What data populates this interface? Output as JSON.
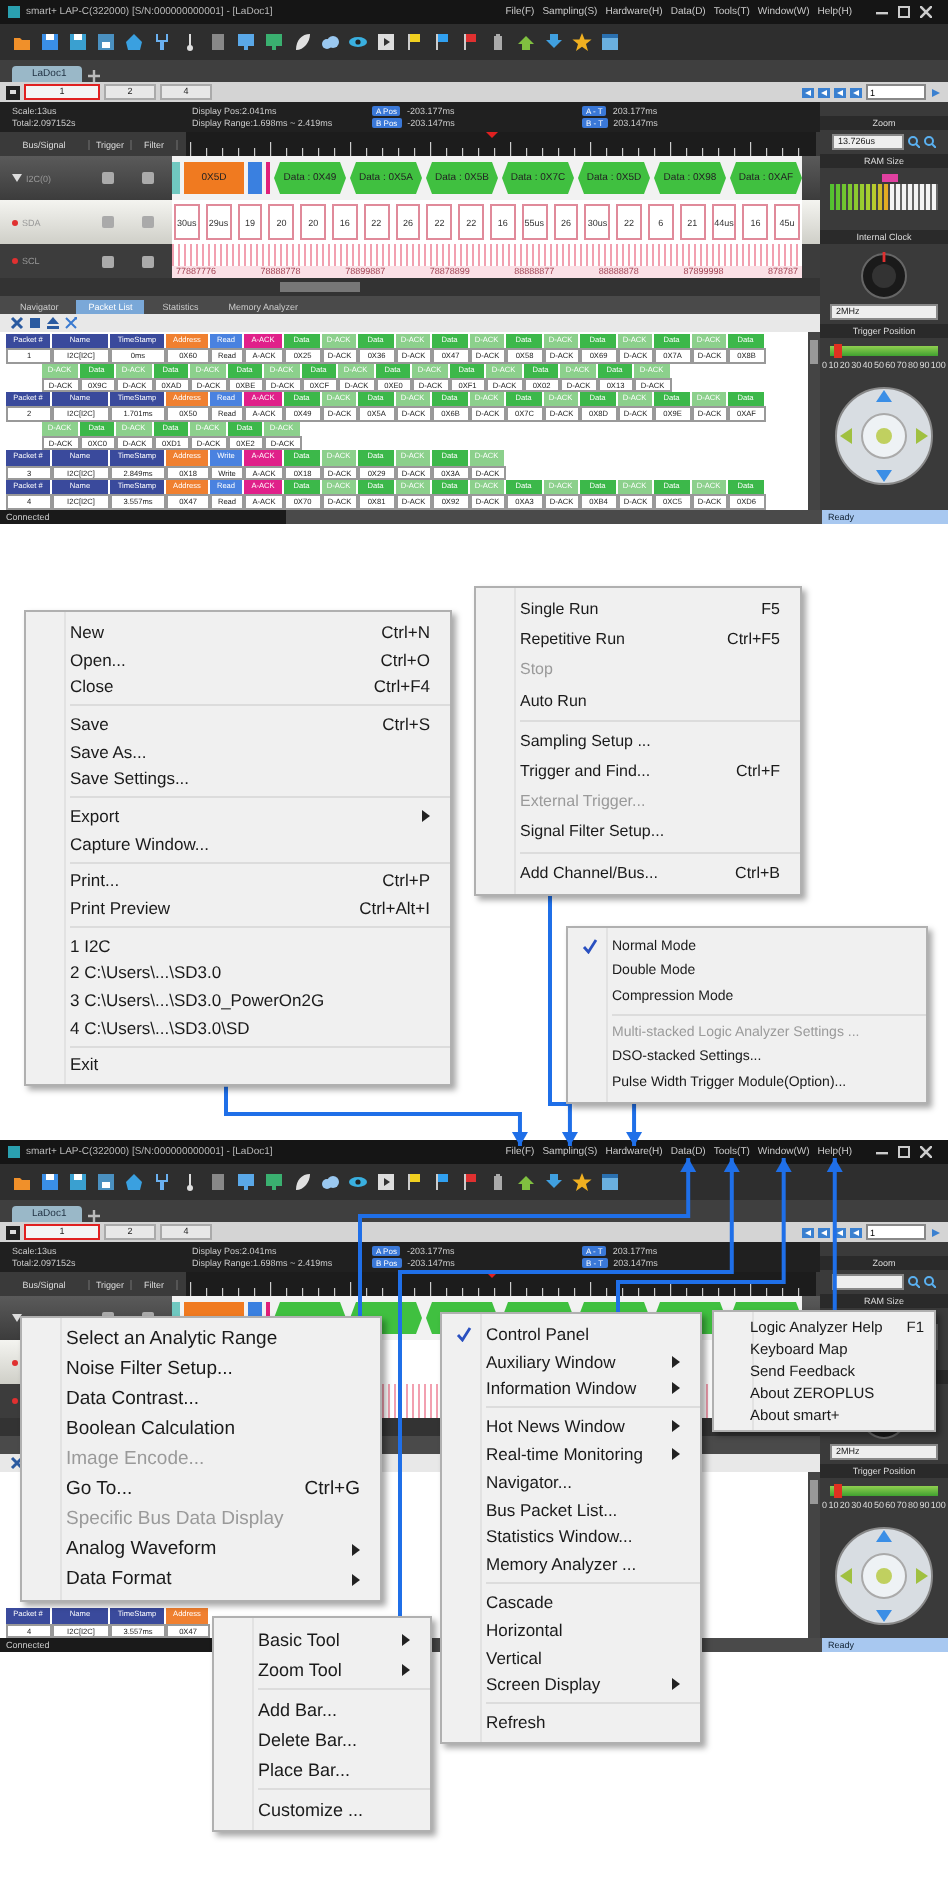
{
  "screens": [
    {
      "title": "smart+ LAP-C(322000) [S/N:000000000001] - [LaDoc1]",
      "menubar": [
        "File(F)",
        "Sampling(S)",
        "Hardware(H)",
        "Data(D)",
        "Tools(T)",
        "Window(W)",
        "Help(H)"
      ],
      "doc_tab": "LaDoc1",
      "page_tabs": [
        {
          "label": "1",
          "selected": true
        },
        {
          "label": "2",
          "selected": false
        },
        {
          "label": "4",
          "selected": false
        }
      ],
      "page_field": "1",
      "info": {
        "scale": "Scale:13us",
        "total": "Total:2.097152s",
        "pos": "Display Pos:2.041ms",
        "range": "Display Range:1.698ms ~ 2.419ms",
        "cursors": [
          {
            "tag": "A Pos",
            "value": "-203.177ms"
          },
          {
            "tag": "B Pos",
            "value": "-203.147ms"
          },
          {
            "tag": "A - T",
            "value": "203.177ms"
          },
          {
            "tag": "B - T",
            "value": "203.147ms"
          }
        ]
      },
      "columns": [
        "Bus/Signal",
        "Trigger",
        "Filter"
      ],
      "signals": [
        {
          "kind": "bus",
          "name": "I2C(0)"
        },
        {
          "kind": "sda",
          "name": "SDA"
        },
        {
          "kind": "scl",
          "name": "SCL"
        }
      ],
      "bus_cells": [
        {
          "kind": "start"
        },
        {
          "kind": "address",
          "label": "0X5D"
        },
        {
          "kind": "rw"
        },
        {
          "kind": "ack"
        },
        {
          "kind": "data",
          "label": "Data : 0X49"
        },
        {
          "kind": "data",
          "label": "Data : 0X5A"
        },
        {
          "kind": "data",
          "label": "Data : 0X5B"
        },
        {
          "kind": "data",
          "label": "Data : 0X7C"
        },
        {
          "kind": "data",
          "label": "Data : 0X5D"
        },
        {
          "kind": "data",
          "label": "Data : 0X98"
        },
        {
          "kind": "data",
          "label": "Data : 0XAF"
        }
      ],
      "sda_pulses": [
        "30us",
        "29us",
        "19",
        "20",
        "20",
        "16",
        "22",
        "26",
        "22",
        "22",
        "16",
        "55us",
        "26",
        "30us",
        "22",
        "6",
        "21",
        "44us",
        "16",
        "45u"
      ],
      "scl_labels": [
        "77887776",
        "78888778",
        "78899887",
        "78878899",
        "88888877",
        "88888878",
        "87899998",
        "878787"
      ],
      "panel_tabs": [
        {
          "label": "Navigator",
          "selected": false
        },
        {
          "label": "Packet List",
          "selected": true
        },
        {
          "label": "Statistics",
          "selected": false
        },
        {
          "label": "Memory Analyzer",
          "selected": false
        }
      ],
      "packets": [
        {
          "heads": [
            "Packet #",
            "Name",
            "TimeStamp"
          ],
          "number": "1",
          "name": "I2C[I2C]",
          "timestamp": "0ms",
          "cells": [
            {
              "kind": "address",
              "head": "Address",
              "value": "0X60"
            },
            {
              "kind": "read",
              "head": "Read",
              "value": "Read"
            },
            {
              "kind": "ack",
              "head": "A-ACK",
              "value": "A-ACK"
            },
            {
              "kind": "data",
              "head": "Data",
              "value": "0X25"
            },
            {
              "kind": "dack",
              "head": "D-ACK",
              "value": "D-ACK"
            },
            {
              "kind": "data",
              "head": "Data",
              "value": "0X36"
            },
            {
              "kind": "dack",
              "head": "D-ACK",
              "value": "D-ACK"
            },
            {
              "kind": "data",
              "head": "Data",
              "value": "0X47"
            },
            {
              "kind": "dack",
              "head": "D-ACK",
              "value": "D-ACK"
            },
            {
              "kind": "data",
              "head": "Data",
              "value": "0X58"
            },
            {
              "kind": "dack",
              "head": "D-ACK",
              "value": "D-ACK"
            },
            {
              "kind": "data",
              "head": "Data",
              "value": "0X69"
            },
            {
              "kind": "dack",
              "head": "D-ACK",
              "value": "D-ACK"
            },
            {
              "kind": "data",
              "head": "Data",
              "value": "0X7A"
            },
            {
              "kind": "dack",
              "head": "D-ACK",
              "value": "D-ACK"
            },
            {
              "kind": "data",
              "head": "Data",
              "value": "0X8B"
            }
          ],
          "more": [
            {
              "kind": "dack",
              "head": "D-ACK",
              "value": "D-ACK"
            },
            {
              "kind": "data",
              "head": "Data",
              "value": "0X9C"
            },
            {
              "kind": "dack",
              "head": "D-ACK",
              "value": "D-ACK"
            },
            {
              "kind": "data",
              "head": "Data",
              "value": "0XAD"
            },
            {
              "kind": "dack",
              "head": "D-ACK",
              "value": "D-ACK"
            },
            {
              "kind": "data",
              "head": "Data",
              "value": "0XBE"
            },
            {
              "kind": "dack",
              "head": "D-ACK",
              "value": "D-ACK"
            },
            {
              "kind": "data",
              "head": "Data",
              "value": "0XCF"
            },
            {
              "kind": "dack",
              "head": "D-ACK",
              "value": "D-ACK"
            },
            {
              "kind": "data",
              "head": "Data",
              "value": "0XE0"
            },
            {
              "kind": "dack",
              "head": "D-ACK",
              "value": "D-ACK"
            },
            {
              "kind": "data",
              "head": "Data",
              "value": "0XF1"
            },
            {
              "kind": "dack",
              "head": "D-ACK",
              "value": "D-ACK"
            },
            {
              "kind": "data",
              "head": "Data",
              "value": "0X02"
            },
            {
              "kind": "dack",
              "head": "D-ACK",
              "value": "D-ACK"
            },
            {
              "kind": "data",
              "head": "Data",
              "value": "0X13"
            },
            {
              "kind": "dack",
              "head": "D-ACK",
              "value": "D-ACK"
            }
          ]
        },
        {
          "heads": [
            "Packet #",
            "Name",
            "TimeStamp"
          ],
          "number": "2",
          "name": "I2C[I2C]",
          "timestamp": "1.701ms",
          "cells": [
            {
              "kind": "address",
              "head": "Address",
              "value": "0X50"
            },
            {
              "kind": "read",
              "head": "Read",
              "value": "Read"
            },
            {
              "kind": "ack",
              "head": "A-ACK",
              "value": "A-ACK"
            },
            {
              "kind": "data",
              "head": "Data",
              "value": "0X49"
            },
            {
              "kind": "dack",
              "head": "D-ACK",
              "value": "D-ACK"
            },
            {
              "kind": "data",
              "head": "Data",
              "value": "0X5A"
            },
            {
              "kind": "dack",
              "head": "D-ACK",
              "value": "D-ACK"
            },
            {
              "kind": "data",
              "head": "Data",
              "value": "0X6B"
            },
            {
              "kind": "dack",
              "head": "D-ACK",
              "value": "D-ACK"
            },
            {
              "kind": "data",
              "head": "Data",
              "value": "0X7C"
            },
            {
              "kind": "dack",
              "head": "D-ACK",
              "value": "D-ACK"
            },
            {
              "kind": "data",
              "head": "Data",
              "value": "0X8D"
            },
            {
              "kind": "dack",
              "head": "D-ACK",
              "value": "D-ACK"
            },
            {
              "kind": "data",
              "head": "Data",
              "value": "0X9E"
            },
            {
              "kind": "dack",
              "head": "D-ACK",
              "value": "D-ACK"
            },
            {
              "kind": "data",
              "head": "Data",
              "value": "0XAF"
            }
          ],
          "more": [
            {
              "kind": "dack",
              "head": "D-ACK",
              "value": "D-ACK"
            },
            {
              "kind": "data",
              "head": "Data",
              "value": "0XC0"
            },
            {
              "kind": "dack",
              "head": "D-ACK",
              "value": "D-ACK"
            },
            {
              "kind": "data",
              "head": "Data",
              "value": "0XD1"
            },
            {
              "kind": "dack",
              "head": "D-ACK",
              "value": "D-ACK"
            },
            {
              "kind": "data",
              "head": "Data",
              "value": "0XE2"
            },
            {
              "kind": "dack",
              "head": "D-ACK",
              "value": "D-ACK"
            }
          ]
        },
        {
          "heads": [
            "Packet #",
            "Name",
            "TimeStamp"
          ],
          "number": "3",
          "name": "I2C[I2C]",
          "timestamp": "2.849ms",
          "cells": [
            {
              "kind": "address",
              "head": "Address",
              "value": "0X18"
            },
            {
              "kind": "write",
              "head": "Write",
              "value": "Write"
            },
            {
              "kind": "ack",
              "head": "A-ACK",
              "value": "A-ACK"
            },
            {
              "kind": "data",
              "head": "Data",
              "value": "0X18"
            },
            {
              "kind": "dack",
              "head": "D-ACK",
              "value": "D-ACK"
            },
            {
              "kind": "data",
              "head": "Data",
              "value": "0X29"
            },
            {
              "kind": "dack",
              "head": "D-ACK",
              "value": "D-ACK"
            },
            {
              "kind": "data",
              "head": "Data",
              "value": "0X3A"
            },
            {
              "kind": "dack",
              "head": "D-ACK",
              "value": "D-ACK"
            }
          ]
        },
        {
          "heads": [
            "Packet #",
            "Name",
            "TimeStamp"
          ],
          "number": "4",
          "name": "I2C[I2C]",
          "timestamp": "3.557ms",
          "cells": [
            {
              "kind": "address",
              "head": "Address",
              "value": "0X47"
            },
            {
              "kind": "read",
              "head": "Read",
              "value": "Read"
            },
            {
              "kind": "ack",
              "head": "A-ACK",
              "value": "A-ACK"
            },
            {
              "kind": "data",
              "head": "Data",
              "value": "0X70"
            },
            {
              "kind": "dack",
              "head": "D-ACK",
              "value": "D-ACK"
            },
            {
              "kind": "data",
              "head": "Data",
              "value": "0X81"
            },
            {
              "kind": "dack",
              "head": "D-ACK",
              "value": "D-ACK"
            },
            {
              "kind": "data",
              "head": "Data",
              "value": "0X92"
            },
            {
              "kind": "dack",
              "head": "D-ACK",
              "value": "D-ACK"
            },
            {
              "kind": "data",
              "head": "Data",
              "value": "0XA3"
            },
            {
              "kind": "dack",
              "head": "D-ACK",
              "value": "D-ACK"
            },
            {
              "kind": "data",
              "head": "Data",
              "value": "0XB4"
            },
            {
              "kind": "dack",
              "head": "D-ACK",
              "value": "D-ACK"
            },
            {
              "kind": "data",
              "head": "Data",
              "value": "0XC5"
            },
            {
              "kind": "dack",
              "head": "D-ACK",
              "value": "D-ACK"
            },
            {
              "kind": "data",
              "head": "Data",
              "value": "0XD6"
            }
          ]
        }
      ],
      "side": {
        "zoom_title": "Zoom",
        "zoom_value": "13.726us",
        "ram_title": "RAM Size",
        "ram_meter": {
          "level": 0.55
        },
        "clock_title": "Internal Clock",
        "clock_value": "2MHz",
        "trigger_title": "Trigger Position",
        "trigger_slider": {
          "level": 0.08
        },
        "trigger_scale": [
          "0",
          "10",
          "20",
          "30",
          "40",
          "50",
          "60",
          "70",
          "80",
          "90",
          "100"
        ]
      },
      "status": {
        "left": "Connected",
        "right": "Ready"
      }
    },
    {
      "title": "smart+ LAP-C(322000) [S/N:000000000001] - [LaDoc1]",
      "menubar": [
        "File(F)",
        "Sampling(S)",
        "Hardware(H)",
        "Data(D)",
        "Tools(T)",
        "Window(W)",
        "Help(H)"
      ],
      "doc_tab": "LaDoc1",
      "page_tabs": [
        {
          "label": "1",
          "selected": true
        },
        {
          "label": "2",
          "selected": false
        },
        {
          "label": "4",
          "selected": false
        }
      ],
      "page_field": "1",
      "info": {
        "scale": "Scale:13us",
        "total": "Total:2.097152s",
        "pos": "Display Pos:2.041ms",
        "range": "Display Range:1.698ms ~ 2.419ms",
        "cursors": [
          {
            "tag": "A Pos",
            "value": "-203.177ms"
          },
          {
            "tag": "B Pos",
            "value": "-203.147ms"
          },
          {
            "tag": "A - T",
            "value": "203.177ms"
          },
          {
            "tag": "B - T",
            "value": "203.147ms"
          }
        ]
      },
      "columns": [
        "Bus/Signal",
        "Trigger",
        "Filter"
      ],
      "signals": [
        {
          "kind": "bus"
        },
        {
          "kind": "sda"
        },
        {
          "kind": "scl"
        }
      ],
      "bus_cells": [
        {
          "kind": "start"
        },
        {
          "kind": "address"
        },
        {
          "kind": "rw"
        },
        {
          "kind": "ack"
        },
        {
          "kind": "data"
        },
        {
          "kind": "data"
        },
        {
          "kind": "data"
        },
        {
          "kind": "data"
        },
        {
          "kind": "data"
        },
        {
          "kind": "data"
        },
        {
          "kind": "data"
        }
      ],
      "packets": [
        {
          "heads": [
            "Packet #",
            "Name",
            "TimeStamp"
          ],
          "number": "4",
          "name": "I2C[I2C]",
          "timestamp": "3.557ms",
          "cells": [
            {
              "kind": "address",
              "head": "Address",
              "value": "0X47"
            }
          ]
        }
      ],
      "side": {
        "zoom_title": "Zoom",
        "ram_title": "RAM Size",
        "clock_value": "2MHz",
        "trigger_title": "Trigger Position",
        "trigger_slider": {
          "level": 0.08
        },
        "trigger_scale": [
          "0",
          "10",
          "20",
          "30",
          "40",
          "50",
          "60",
          "70",
          "80",
          "90",
          "100"
        ]
      },
      "status": {
        "left": "Connected",
        "right": "Ready"
      }
    }
  ],
  "menus": [
    {
      "groups": [
        [
          {
            "label": "New",
            "shortcut": "Ctrl+N",
            "disabled": false,
            "checked": false,
            "submenu": false
          },
          {
            "label": "Open...",
            "shortcut": "Ctrl+O",
            "disabled": false,
            "checked": false,
            "submenu": false
          },
          {
            "label": "Close",
            "shortcut": "Ctrl+F4",
            "disabled": false,
            "checked": false,
            "submenu": false
          }
        ],
        [
          {
            "label": "Save",
            "shortcut": "Ctrl+S",
            "disabled": false,
            "checked": false,
            "submenu": false
          },
          {
            "label": "Save As...",
            "disabled": false,
            "checked": false,
            "submenu": false
          },
          {
            "label": "Save Settings...",
            "disabled": false,
            "checked": false,
            "submenu": false
          }
        ],
        [
          {
            "label": "Export",
            "disabled": false,
            "checked": false,
            "submenu": true
          },
          {
            "label": "Capture Window...",
            "disabled": false,
            "checked": false,
            "submenu": false
          }
        ],
        [
          {
            "label": "Print...",
            "shortcut": "Ctrl+P",
            "disabled": false,
            "checked": false,
            "submenu": false
          },
          {
            "label": "Print Preview",
            "shortcut": "Ctrl+Alt+I",
            "disabled": false,
            "checked": false,
            "submenu": false
          }
        ],
        [
          {
            "label": "1 I2C",
            "disabled": false,
            "checked": false,
            "submenu": false
          },
          {
            "label": "2 C:\\Users\\...\\SD3.0",
            "disabled": false,
            "checked": false,
            "submenu": false
          },
          {
            "label": "3 C:\\Users\\...\\SD3.0_PowerOn2G",
            "disabled": false,
            "checked": false,
            "submenu": false
          },
          {
            "label": "4 C:\\Users\\...\\SD3.0\\SD",
            "disabled": false,
            "checked": false,
            "submenu": false
          }
        ],
        [
          {
            "label": "Exit",
            "disabled": false,
            "checked": false,
            "submenu": false
          }
        ]
      ]
    },
    {
      "groups": [
        [
          {
            "label": "Single Run",
            "shortcut": "F5",
            "disabled": false,
            "checked": false,
            "submenu": false
          },
          {
            "label": "Repetitive Run",
            "shortcut": "Ctrl+F5",
            "disabled": false,
            "checked": false,
            "submenu": false
          },
          {
            "label": "Stop",
            "disabled": true,
            "checked": false,
            "submenu": false
          },
          {
            "label": "Auto Run",
            "disabled": false,
            "checked": false,
            "submenu": false
          }
        ],
        [
          {
            "label": "Sampling Setup ...",
            "disabled": false,
            "checked": false,
            "submenu": false
          },
          {
            "label": "Trigger and Find...",
            "shortcut": "Ctrl+F",
            "disabled": false,
            "checked": false,
            "submenu": false
          },
          {
            "label": "External Trigger...",
            "disabled": true,
            "checked": false,
            "submenu": false
          },
          {
            "label": "Signal Filter Setup...",
            "disabled": false,
            "checked": false,
            "submenu": false
          }
        ],
        [
          {
            "label": "Add Channel/Bus...",
            "shortcut": "Ctrl+B",
            "disabled": false,
            "checked": false,
            "submenu": false
          }
        ]
      ]
    },
    {
      "groups": [
        [
          {
            "label": "Normal Mode",
            "disabled": false,
            "checked": true,
            "submenu": false
          },
          {
            "label": "Double Mode",
            "disabled": false,
            "checked": false,
            "submenu": false
          },
          {
            "label": "Compression Mode",
            "disabled": false,
            "checked": false,
            "submenu": false
          }
        ],
        [
          {
            "label": "Multi-stacked Logic Analyzer Settings ...",
            "disabled": true,
            "checked": false,
            "submenu": false
          },
          {
            "label": "DSO-stacked Settings...",
            "disabled": false,
            "checked": false,
            "submenu": false
          },
          {
            "label": "Pulse Width Trigger Module(Option)...",
            "disabled": false,
            "checked": false,
            "submenu": false
          }
        ]
      ]
    },
    {
      "groups": [
        [
          {
            "label": "Select an Analytic Range",
            "disabled": false,
            "checked": false,
            "submenu": false
          },
          {
            "label": "Noise Filter Setup...",
            "disabled": false,
            "checked": false,
            "submenu": false
          },
          {
            "label": "Data Contrast...",
            "disabled": false,
            "checked": false,
            "submenu": false
          },
          {
            "label": "Boolean Calculation",
            "disabled": false,
            "checked": false,
            "submenu": false
          },
          {
            "label": "Image Encode...",
            "disabled": true,
            "checked": false,
            "submenu": false
          },
          {
            "label": "Go To...",
            "shortcut": "Ctrl+G",
            "disabled": false,
            "checked": false,
            "submenu": false
          },
          {
            "label": "Specific Bus Data Display",
            "disabled": true,
            "checked": false,
            "submenu": false
          },
          {
            "label": "Analog Waveform",
            "disabled": false,
            "checked": false,
            "submenu": true
          },
          {
            "label": "Data Format",
            "disabled": false,
            "checked": false,
            "submenu": true
          }
        ]
      ]
    },
    {
      "groups": [
        [
          {
            "label": "Basic Tool",
            "disabled": false,
            "checked": false,
            "submenu": true
          },
          {
            "label": "Zoom Tool",
            "disabled": false,
            "checked": false,
            "submenu": true
          }
        ],
        [
          {
            "label": "Add Bar...",
            "disabled": false,
            "checked": false,
            "submenu": false
          },
          {
            "label": "Delete Bar...",
            "disabled": false,
            "checked": false,
            "submenu": false
          },
          {
            "label": "Place Bar...",
            "disabled": false,
            "checked": false,
            "submenu": false
          }
        ],
        [
          {
            "label": "Customize ...",
            "disabled": false,
            "checked": false,
            "submenu": false
          }
        ]
      ]
    },
    {
      "groups": [
        [
          {
            "label": "Control Panel",
            "disabled": false,
            "checked": true,
            "submenu": false
          },
          {
            "label": "Auxiliary Window",
            "disabled": false,
            "checked": false,
            "submenu": true
          },
          {
            "label": "Information Window",
            "disabled": false,
            "checked": false,
            "submenu": true
          }
        ],
        [
          {
            "label": "Hot News Window",
            "disabled": false,
            "checked": false,
            "submenu": true
          },
          {
            "label": "Real-time Monitoring",
            "disabled": false,
            "checked": false,
            "submenu": true
          },
          {
            "label": "Navigator...",
            "disabled": false,
            "checked": false,
            "submenu": false
          },
          {
            "label": "Bus Packet List...",
            "disabled": false,
            "checked": false,
            "submenu": false
          },
          {
            "label": "Statistics Window...",
            "disabled": false,
            "checked": false,
            "submenu": false
          },
          {
            "label": "Memory Analyzer ...",
            "disabled": false,
            "checked": false,
            "submenu": false
          }
        ],
        [
          {
            "label": "Cascade",
            "disabled": false,
            "checked": false,
            "submenu": false
          },
          {
            "label": "Horizontal",
            "disabled": false,
            "checked": false,
            "submenu": false
          },
          {
            "label": "Vertical",
            "disabled": false,
            "checked": false,
            "submenu": false
          },
          {
            "label": "Screen Display",
            "disabled": false,
            "checked": false,
            "submenu": true
          }
        ],
        [
          {
            "label": "Refresh",
            "disabled": false,
            "checked": false,
            "submenu": false
          }
        ]
      ]
    },
    {
      "groups": [
        [
          {
            "label": "Logic Analyzer Help",
            "shortcut": "F1",
            "disabled": false,
            "checked": false,
            "submenu": false
          },
          {
            "label": "Keyboard Map",
            "disabled": false,
            "checked": false,
            "submenu": false
          },
          {
            "label": "Send Feedback",
            "disabled": false,
            "checked": false,
            "submenu": false
          },
          {
            "label": "About ZEROPLUS",
            "disabled": false,
            "checked": false,
            "submenu": false
          },
          {
            "label": "About smart+",
            "disabled": false,
            "checked": false,
            "submenu": false
          }
        ]
      ]
    }
  ]
}
